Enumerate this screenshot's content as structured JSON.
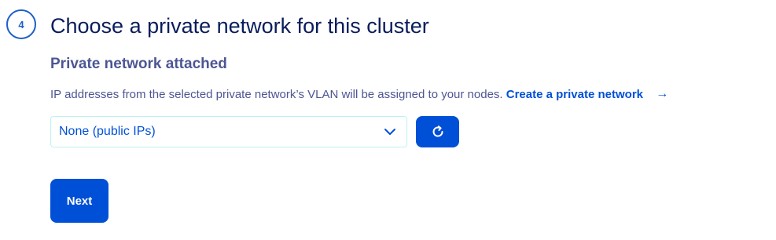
{
  "step": {
    "number": "4",
    "title": "Choose a private network for this cluster"
  },
  "section": {
    "title": "Private network attached",
    "description": "IP addresses from the selected private network’s VLAN will be assigned to your nodes.",
    "create_link_label": "Create a private network",
    "create_link_arrow": "→"
  },
  "network_select": {
    "selected_value": "None (public IPs)",
    "icon": "chevron-down-icon"
  },
  "refresh_button": {
    "icon": "refresh-icon"
  },
  "actions": {
    "next_label": "Next"
  },
  "colors": {
    "primary": "#0050d7",
    "heading": "#0a1d5c",
    "text": "#4d5693",
    "select_border": "#bef1f1"
  }
}
